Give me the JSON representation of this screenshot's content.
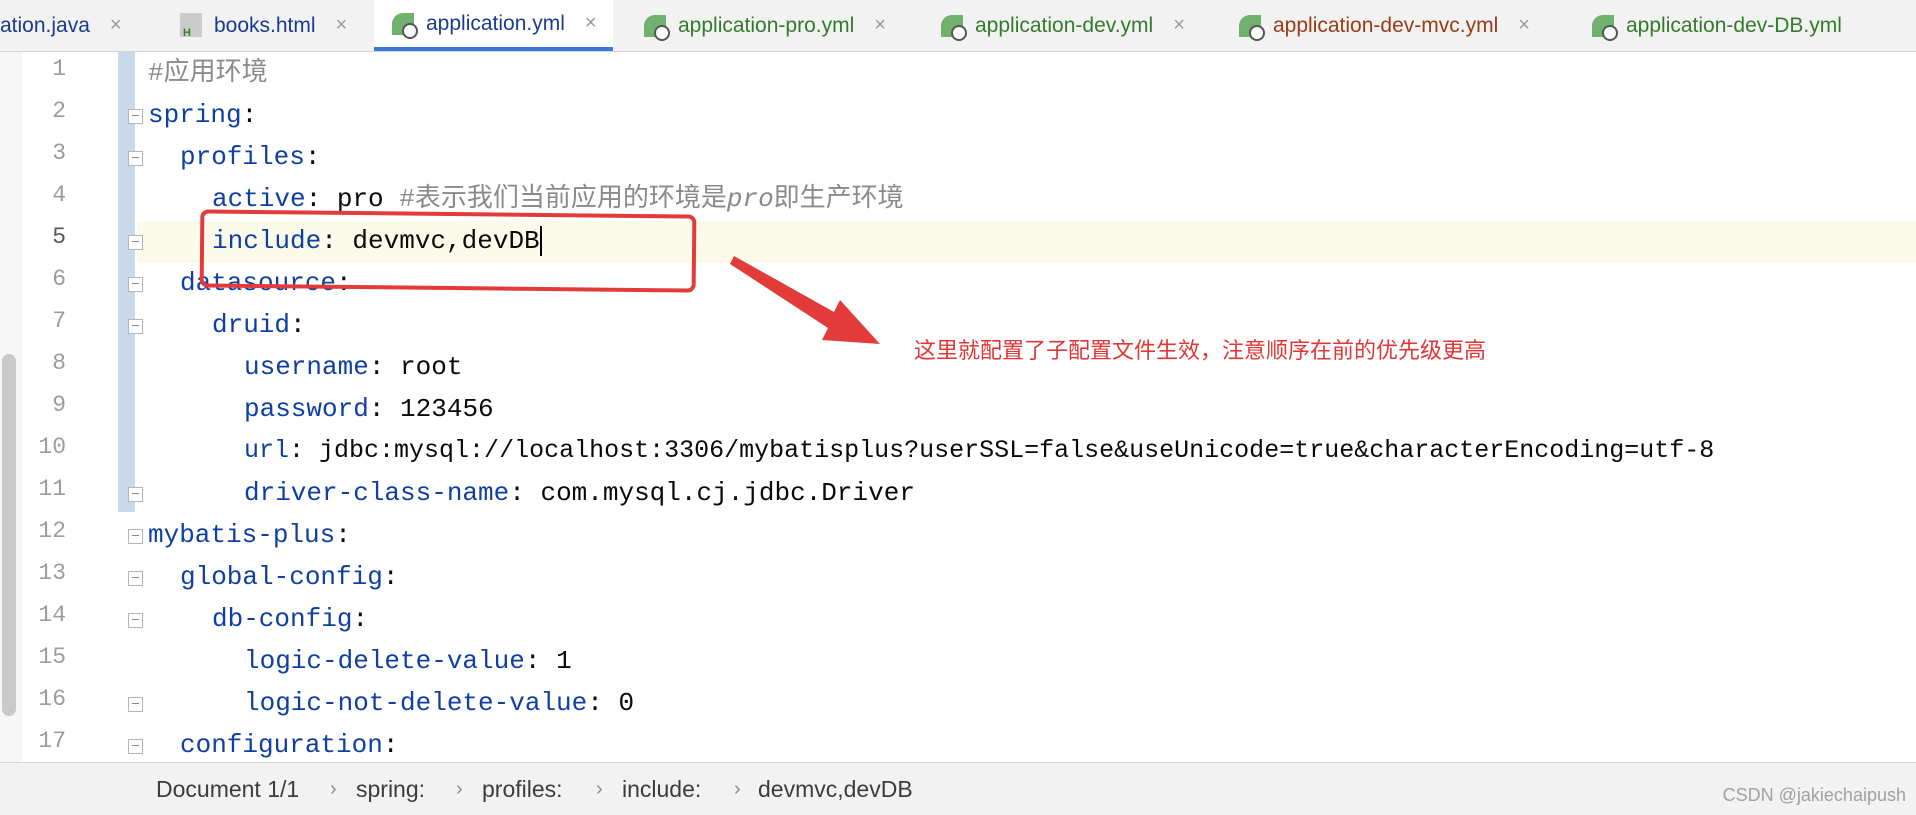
{
  "tabs": [
    {
      "label": "ation.java",
      "color": "#1b3b8f",
      "icon": "java-file-icon"
    },
    {
      "label": "books.html",
      "color": "#1b3b8f",
      "icon": "html-file-icon"
    },
    {
      "label": "application.yml",
      "color": "#1b3b8f",
      "icon": "spring-yaml-icon",
      "active": true
    },
    {
      "label": "application-pro.yml",
      "color": "#347a2c",
      "icon": "spring-yaml-icon"
    },
    {
      "label": "application-dev.yml",
      "color": "#347a2c",
      "icon": "spring-yaml-icon"
    },
    {
      "label": "application-dev-mvc.yml",
      "color": "#9a3b16",
      "icon": "spring-yaml-icon"
    },
    {
      "label": "application-dev-DB.yml",
      "color": "#347a2c",
      "icon": "spring-yaml-icon"
    }
  ],
  "close_glyph": "×",
  "line_numbers": [
    "1",
    "2",
    "3",
    "4",
    "5",
    "6",
    "7",
    "8",
    "9",
    "10",
    "11",
    "12",
    "13",
    "14",
    "15",
    "16",
    "17"
  ],
  "code": {
    "l1": "#应用环境",
    "l2_key": "spring",
    "colon": ":",
    "l3_key": "profiles",
    "l4_key": "active",
    "l4_val": " pro ",
    "l4_c1": "#表示我们当前应用的环境是",
    "l4_c2": "pro",
    "l4_c3": "即生产环境",
    "l5_key": "include",
    "l5_val": " devmvc,devDB",
    "l6_key": "datasource",
    "l7_key": "druid",
    "l8_key": "username",
    "l8_val": " root",
    "l9_key": "password",
    "l9_val": " 123456",
    "l10_key": "url",
    "l10_val": " jdbc:mysql://localhost:3306/mybatisplus?userSSL=false&useUnicode=true&characterEncoding=utf-8",
    "l11_key": "driver-class-name",
    "l11_val": " com.mysql.cj.jdbc.Driver",
    "l12_key": "mybatis-plus",
    "l13_key": "global-config",
    "l14_key": "db-config",
    "l15_key": "logic-delete-value",
    "l15_val": " 1",
    "l16_key": "logic-not-delete-value",
    "l16_val": " 0",
    "l17_key": "configuration"
  },
  "annotation": {
    "note": "这里就配置了子配置文件生效，注意顺序在前的优先级更高",
    "color": "#e33a3a"
  },
  "breadcrumb": [
    "Document 1/1",
    "spring:",
    "profiles:",
    "include:",
    "devmvc,devDB"
  ],
  "breadcrumb_sep": "›",
  "watermark": "CSDN @jakiechaipush"
}
